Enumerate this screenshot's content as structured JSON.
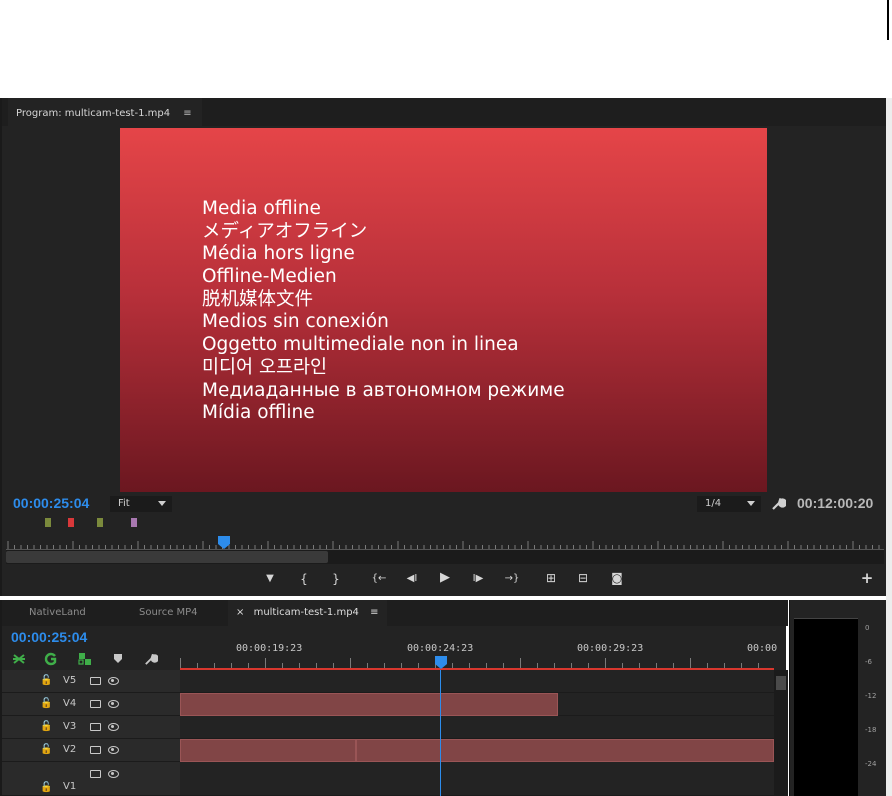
{
  "program": {
    "tab_label": "Program: multicam-test-1.mp4",
    "tab_menu": "≡",
    "offline_lines": [
      "Media offline",
      "メディアオフライン",
      "Média hors ligne",
      "Offline-Medien",
      "脱机媒体文件",
      "Medios sin conexión",
      "Oggetto multimediale non in linea",
      "미디어 오프라인",
      "Медиаданные в автономном режиме",
      "Mídia offline"
    ],
    "playhead_timecode": "00:00:25:04",
    "fit_dropdown": "Fit",
    "resolution_dropdown": "1/4",
    "duration_timecode": "00:12:00:20",
    "marker_colors": [
      "#7b8a3c",
      "#d8383a",
      "#7b8a3c",
      "#a878b0"
    ],
    "controls": {
      "add_marker": "▼",
      "mark_in": "{",
      "mark_out": "}",
      "go_to_in": "{←",
      "step_back": "◀I",
      "play": "▶",
      "step_forward": "I▶",
      "go_to_out": "→}",
      "lift": "⊞",
      "extract": "⊟",
      "export_frame": "◙",
      "add": "+"
    }
  },
  "timeline": {
    "tabs": [
      {
        "label": "NativeLand"
      },
      {
        "label": "Source MP4"
      },
      {
        "label": "multicam-test-1.mp4",
        "close": "×",
        "menu": "≡"
      }
    ],
    "playhead_timecode": "00:00:25:04",
    "ruler_labels": [
      "00:00:19:23",
      "00:00:24:23",
      "00:00:29:23",
      "00:00"
    ],
    "tracks": [
      {
        "name": "V5"
      },
      {
        "name": "V4"
      },
      {
        "name": "V3"
      },
      {
        "name": "V2"
      },
      {
        "name": "V1"
      }
    ],
    "lock_glyph": "🔓"
  },
  "meter": {
    "db_labels": [
      "0",
      "-6",
      "-12",
      "-18",
      "-24"
    ]
  },
  "colors": {
    "panel_bg": "#232323",
    "timecode_blue": "#2d8ceb",
    "clip_fill": "#814546",
    "work_area": "#d8372e"
  }
}
